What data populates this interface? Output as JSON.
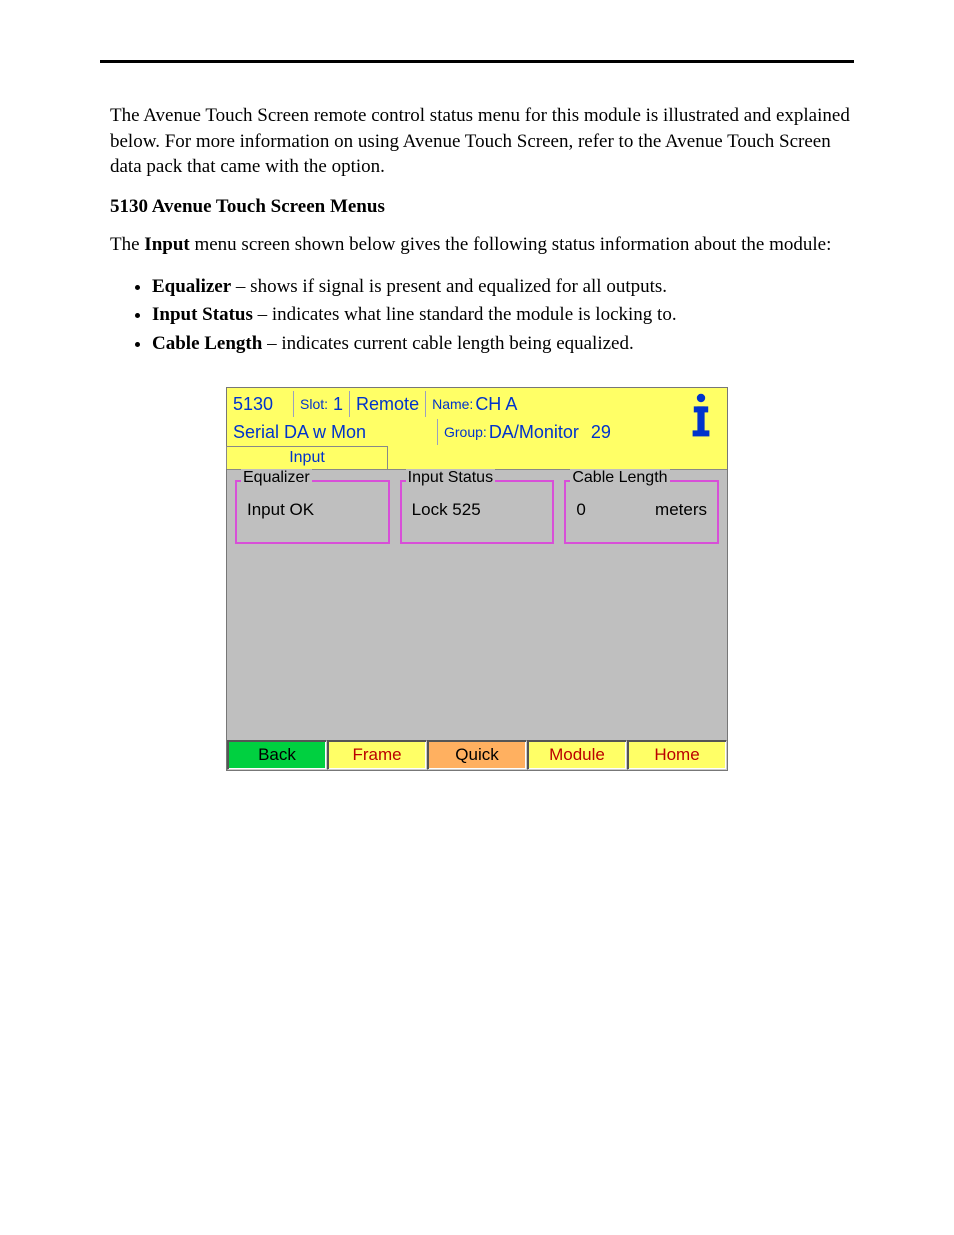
{
  "doc": {
    "intro": "The Avenue Touch Screen remote control status menu for this module is illustrated and explained below. For more information on using Avenue Touch Screen, refer to the Avenue Touch Screen data pack that came with the option.",
    "heading": "5130 Avenue Touch Screen Menus",
    "para2_pre": "The ",
    "para2_bold": "Input",
    "para2_post": " menu screen shown below gives the following status information about the module:",
    "bullets": [
      {
        "term": "Equalizer",
        "desc": " – shows if signal is present and equalized for all outputs."
      },
      {
        "term": "Input Status",
        "desc": " – indicates what line standard the module is locking to."
      },
      {
        "term": "Cable Length",
        "desc": " – indicates current cable length being equalized."
      }
    ]
  },
  "ts": {
    "header": {
      "model": "5130",
      "slot_label": "Slot:",
      "slot_value": "1",
      "remote": "Remote",
      "name_label": "Name:",
      "name_value": "CH A",
      "line2_left": "Serial DA w Mon",
      "group_label": "Group:",
      "group_value": "DA/Monitor",
      "number": "29"
    },
    "tab": {
      "input": "Input"
    },
    "status": {
      "equalizer_label": "Equalizer",
      "equalizer_value": "Input OK",
      "input_status_label": "Input Status",
      "input_status_value": "Lock 525",
      "cable_label": "Cable Length",
      "cable_value": "0",
      "cable_units": "meters"
    },
    "buttons": {
      "back": "Back",
      "frame": "Frame",
      "quick": "Quick",
      "module": "Module",
      "home": "Home"
    }
  }
}
